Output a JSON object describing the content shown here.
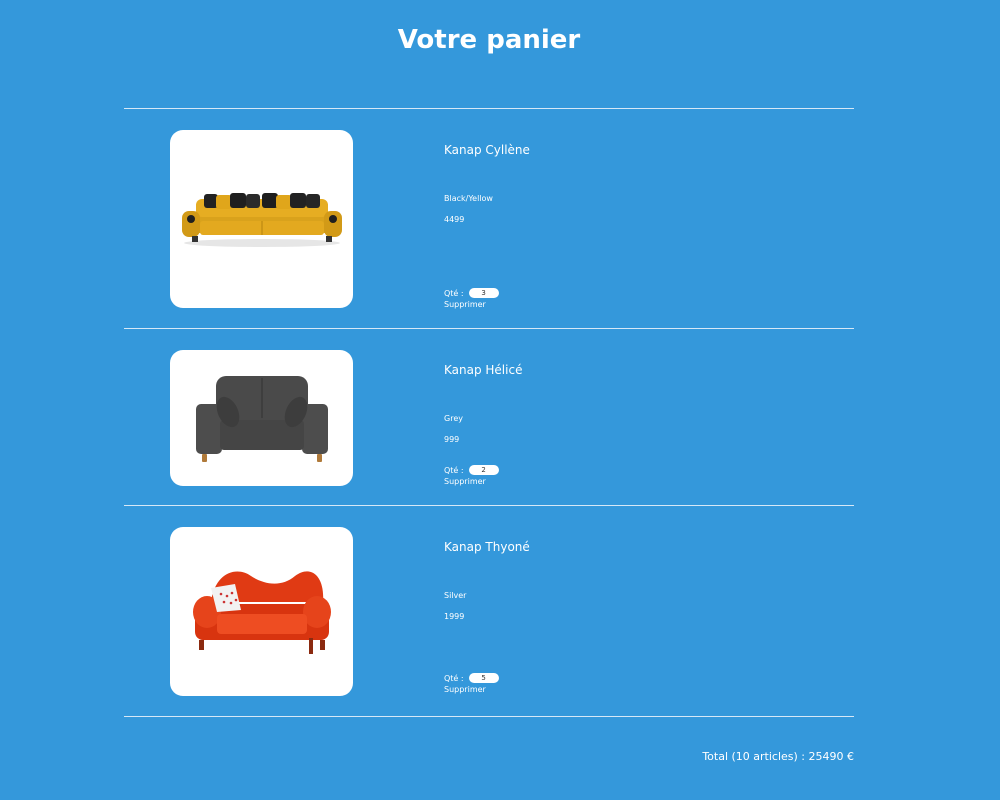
{
  "page": {
    "title": "Votre panier",
    "background": "#3498db"
  },
  "cart": {
    "items": [
      {
        "name": "Kanap Cyllène",
        "color": "Black/Yellow",
        "price": "4499",
        "qty_label": "Qté :",
        "quantity": "3",
        "delete_label": "Supprimer",
        "image": "yellow-sofa-image"
      },
      {
        "name": "Kanap Hélicé",
        "color": "Grey",
        "price": "999",
        "qty_label": "Qté :",
        "quantity": "2",
        "delete_label": "Supprimer",
        "image": "grey-sofa-image"
      },
      {
        "name": "Kanap Thyoné",
        "color": "Silver",
        "price": "1999",
        "qty_label": "Qté :",
        "quantity": "5",
        "delete_label": "Supprimer",
        "image": "red-sofa-image"
      }
    ],
    "total_text": "Total (10 articles) : 25490 €"
  }
}
